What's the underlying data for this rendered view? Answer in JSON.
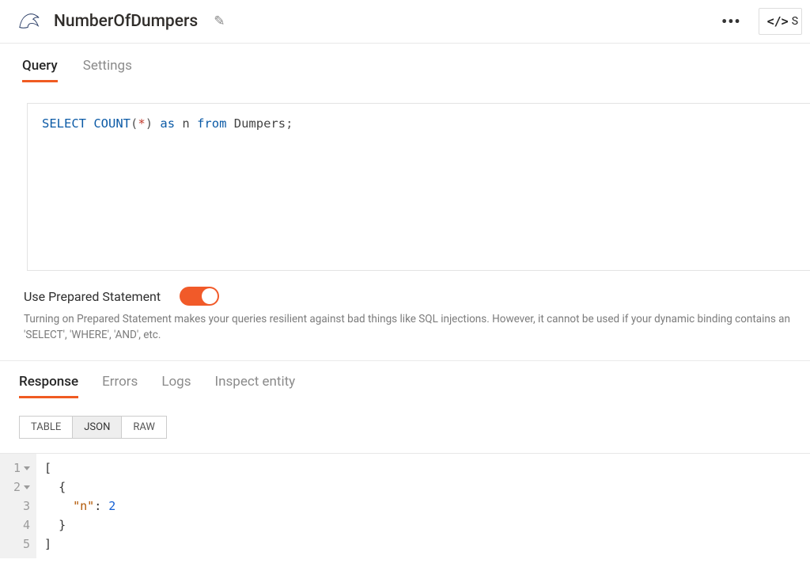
{
  "header": {
    "title": "NumberOfDumpers",
    "code_button_cropped_text": "S"
  },
  "top_tabs": [
    {
      "label": "Query",
      "active": true
    },
    {
      "label": "Settings",
      "active": false
    }
  ],
  "sql": {
    "tokens": {
      "select": "SELECT",
      "count": "COUNT",
      "lparen": "(",
      "star": "*",
      "rparen": ")",
      "as": "as",
      "alias": "n",
      "from": "from",
      "table": "Dumpers",
      "semi": ";"
    }
  },
  "prepared": {
    "label": "Use Prepared Statement",
    "on": true,
    "help": "Turning on Prepared Statement makes your queries resilient against bad things like SQL injections. However, it cannot be used if your dynamic binding contains an 'SELECT', 'WHERE', 'AND', etc."
  },
  "response_tabs": [
    {
      "label": "Response",
      "active": true
    },
    {
      "label": "Errors",
      "active": false
    },
    {
      "label": "Logs",
      "active": false
    },
    {
      "label": "Inspect entity",
      "active": false
    }
  ],
  "format_segments": [
    {
      "label": "TABLE",
      "active": false
    },
    {
      "label": "JSON",
      "active": true
    },
    {
      "label": "RAW",
      "active": false
    }
  ],
  "json_result": {
    "line_numbers": [
      "1",
      "2",
      "3",
      "4",
      "5"
    ],
    "has_fold": [
      true,
      true,
      false,
      false,
      false
    ],
    "lines": {
      "l1": "[",
      "l2_open": "{",
      "l3_key": "\"n\"",
      "l3_colon": ": ",
      "l3_val": "2",
      "l4": "}",
      "l5": "]"
    }
  }
}
